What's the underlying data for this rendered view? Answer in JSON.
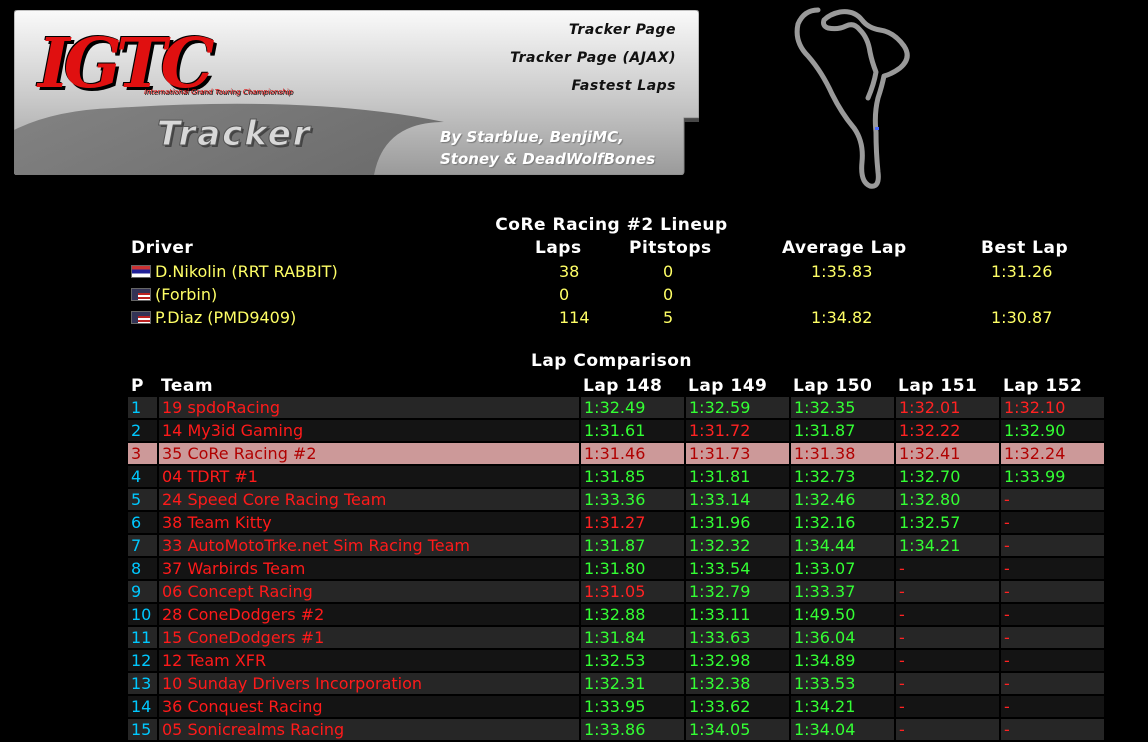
{
  "header": {
    "logo_text": "IGTC",
    "logo_subtitle": "International Grand Touring Championship",
    "tracker_word": "Tracker",
    "credits_line1": "By Starblue, BenjiMC,",
    "credits_line2": "Stoney & DeadWolfBones",
    "links": [
      "Tracker Page",
      "Tracker Page (AJAX)",
      "Fastest Laps"
    ]
  },
  "lineup": {
    "title": "CoRe Racing #2 Lineup",
    "columns": {
      "driver": "Driver",
      "laps": "Laps",
      "pitstops": "Pitstops",
      "avg": "Average Lap",
      "best": "Best Lap"
    },
    "drivers": [
      {
        "flag": "rs-flag",
        "name": "D.Nikolin (RRT RABBIT)",
        "laps": "38",
        "pitstops": "0",
        "avg": "1:35.83",
        "best": "1:31.26"
      },
      {
        "flag": "us-flag",
        "name": "(Forbin)",
        "laps": "0",
        "pitstops": "0",
        "avg": "",
        "best": ""
      },
      {
        "flag": "us-flag",
        "name": "P.Diaz (PMD9409)",
        "laps": "114",
        "pitstops": "5",
        "avg": "1:34.82",
        "best": "1:30.87"
      }
    ]
  },
  "laps": {
    "title": "Lap Comparison",
    "columns": [
      "P",
      "Team",
      "Lap 148",
      "Lap 149",
      "Lap 150",
      "Lap 151",
      "Lap 152"
    ],
    "highlight_team": "35 CoRe Racing #2",
    "rows": [
      {
        "p": "1",
        "team": "19 spdoRacing",
        "laps": [
          [
            "1:32.49",
            "g"
          ],
          [
            "1:32.59",
            "g"
          ],
          [
            "1:32.35",
            "g"
          ],
          [
            "1:32.01",
            "r"
          ],
          [
            "1:32.10",
            "r"
          ]
        ]
      },
      {
        "p": "2",
        "team": "14 My3id Gaming",
        "laps": [
          [
            "1:31.61",
            "g"
          ],
          [
            "1:31.72",
            "r"
          ],
          [
            "1:31.87",
            "g"
          ],
          [
            "1:32.22",
            "r"
          ],
          [
            "1:32.90",
            "g"
          ]
        ]
      },
      {
        "p": "3",
        "team": "35 CoRe Racing #2",
        "laps": [
          [
            "1:31.46",
            "h"
          ],
          [
            "1:31.73",
            "h"
          ],
          [
            "1:31.38",
            "h"
          ],
          [
            "1:32.41",
            "h"
          ],
          [
            "1:32.24",
            "h"
          ]
        ]
      },
      {
        "p": "4",
        "team": "04 TDRT #1",
        "laps": [
          [
            "1:31.85",
            "g"
          ],
          [
            "1:31.81",
            "g"
          ],
          [
            "1:32.73",
            "g"
          ],
          [
            "1:32.70",
            "g"
          ],
          [
            "1:33.99",
            "g"
          ]
        ]
      },
      {
        "p": "5",
        "team": "24 Speed Core Racing Team",
        "laps": [
          [
            "1:33.36",
            "g"
          ],
          [
            "1:33.14",
            "g"
          ],
          [
            "1:32.46",
            "g"
          ],
          [
            "1:32.80",
            "g"
          ],
          [
            "-",
            "r"
          ]
        ]
      },
      {
        "p": "6",
        "team": "38 Team Kitty",
        "laps": [
          [
            "1:31.27",
            "r"
          ],
          [
            "1:31.96",
            "g"
          ],
          [
            "1:32.16",
            "g"
          ],
          [
            "1:32.57",
            "g"
          ],
          [
            "-",
            "r"
          ]
        ]
      },
      {
        "p": "7",
        "team": "33 AutoMotoTrke.net Sim Racing Team",
        "laps": [
          [
            "1:31.87",
            "g"
          ],
          [
            "1:32.32",
            "g"
          ],
          [
            "1:34.44",
            "g"
          ],
          [
            "1:34.21",
            "g"
          ],
          [
            "-",
            "r"
          ]
        ]
      },
      {
        "p": "8",
        "team": "37 Warbirds Team",
        "laps": [
          [
            "1:31.80",
            "g"
          ],
          [
            "1:33.54",
            "g"
          ],
          [
            "1:33.07",
            "g"
          ],
          [
            "-",
            "r"
          ],
          [
            "-",
            "r"
          ]
        ]
      },
      {
        "p": "9",
        "team": "06 Concept Racing",
        "laps": [
          [
            "1:31.05",
            "r"
          ],
          [
            "1:32.79",
            "g"
          ],
          [
            "1:33.37",
            "g"
          ],
          [
            "-",
            "r"
          ],
          [
            "-",
            "r"
          ]
        ]
      },
      {
        "p": "10",
        "team": "28 ConeDodgers #2",
        "laps": [
          [
            "1:32.88",
            "g"
          ],
          [
            "1:33.11",
            "g"
          ],
          [
            "1:49.50",
            "g"
          ],
          [
            "-",
            "r"
          ],
          [
            "-",
            "r"
          ]
        ]
      },
      {
        "p": "11",
        "team": "15 ConeDodgers #1",
        "laps": [
          [
            "1:31.84",
            "g"
          ],
          [
            "1:33.63",
            "g"
          ],
          [
            "1:36.04",
            "g"
          ],
          [
            "-",
            "r"
          ],
          [
            "-",
            "r"
          ]
        ]
      },
      {
        "p": "12",
        "team": "12 Team XFR",
        "laps": [
          [
            "1:32.53",
            "g"
          ],
          [
            "1:32.98",
            "g"
          ],
          [
            "1:34.89",
            "g"
          ],
          [
            "-",
            "r"
          ],
          [
            "-",
            "r"
          ]
        ]
      },
      {
        "p": "13",
        "team": "10 Sunday Drivers Incorporation",
        "laps": [
          [
            "1:32.31",
            "g"
          ],
          [
            "1:32.38",
            "g"
          ],
          [
            "1:33.53",
            "g"
          ],
          [
            "-",
            "r"
          ],
          [
            "-",
            "r"
          ]
        ]
      },
      {
        "p": "14",
        "team": "36 Conquest Racing",
        "laps": [
          [
            "1:33.95",
            "g"
          ],
          [
            "1:33.62",
            "g"
          ],
          [
            "1:34.21",
            "g"
          ],
          [
            "-",
            "r"
          ],
          [
            "-",
            "r"
          ]
        ]
      },
      {
        "p": "15",
        "team": "05 Sonicrealms Racing",
        "laps": [
          [
            "1:33.86",
            "g"
          ],
          [
            "1:34.05",
            "g"
          ],
          [
            "1:34.04",
            "g"
          ],
          [
            "-",
            "r"
          ],
          [
            "-",
            "r"
          ]
        ]
      }
    ]
  },
  "colors": {
    "background": "#000000",
    "lap_green": "#33ff33",
    "lap_red": "#ff2222",
    "position": "#00c8ff",
    "team": "#ff1a1a",
    "lineup_values": "#ffff66",
    "highlight_row": "#cc9999"
  }
}
